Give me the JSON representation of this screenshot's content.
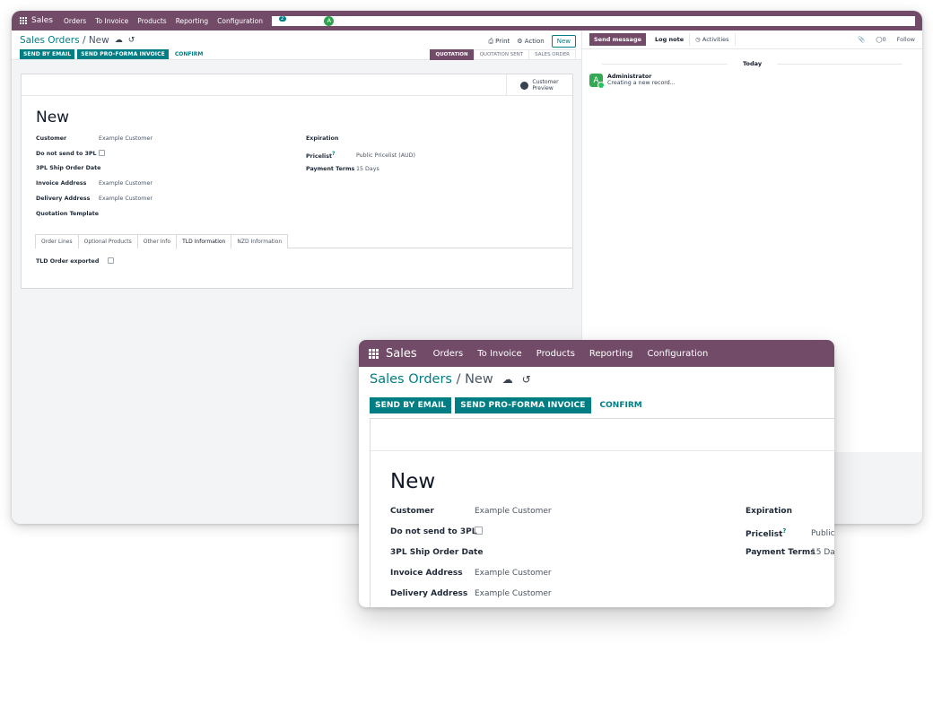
{
  "nav": {
    "app": "Sales",
    "menu": [
      "Orders",
      "To Invoice",
      "Products",
      "Reporting",
      "Configuration"
    ],
    "chat_count": "2",
    "user_initial": "A",
    "user_name": "Administrator"
  },
  "breadcrumb": {
    "parent": "Sales Orders",
    "sep": " / ",
    "current": "New"
  },
  "toolbar": {
    "print": "Print",
    "action": "Action",
    "new": "New"
  },
  "actions": {
    "send_email": "SEND BY EMAIL",
    "send_proforma": "SEND PRO-FORMA INVOICE",
    "confirm": "CONFIRM"
  },
  "stages": [
    "QUOTATION",
    "QUOTATION SENT",
    "SALES ORDER"
  ],
  "active_stage": "QUOTATION",
  "preview": {
    "line1": "Customer",
    "line2": "Preview"
  },
  "record": {
    "title": "New"
  },
  "fields_left": [
    {
      "label": "Customer",
      "value": "Example Customer"
    },
    {
      "label": "Do not send to 3PL",
      "value": ""
    },
    {
      "label": "3PL Ship Order Date",
      "value": ""
    },
    {
      "label": "Invoice Address",
      "value": "Example Customer"
    },
    {
      "label": "Delivery Address",
      "value": "Example Customer"
    },
    {
      "label": "Quotation Template",
      "value": ""
    }
  ],
  "fields_right": [
    {
      "label": "Expiration",
      "value": ""
    },
    {
      "label": "Pricelist",
      "help": "?",
      "value": "Public Pricelist (AUD)"
    },
    {
      "label": "Payment Terms",
      "value": "15 Days"
    }
  ],
  "zoom_values": {
    "pricelist_cut": "Public",
    "payment_cut": "15 Day"
  },
  "tabs": [
    "Order Lines",
    "Optional Products",
    "Other Info",
    "TLD Information",
    "NZD Information"
  ],
  "active_tab": "TLD Information",
  "tld": {
    "label": "TLD Order exported"
  },
  "chatter": {
    "send_message": "Send message",
    "log_note": "Log note",
    "activities": "Activities",
    "attachments": "0",
    "follow": "Follow",
    "today": "Today",
    "author": "Administrator",
    "author_initial": "A",
    "body": "Creating a new record..."
  },
  "colors": {
    "brand": "#714b67",
    "primary": "#017e84"
  }
}
